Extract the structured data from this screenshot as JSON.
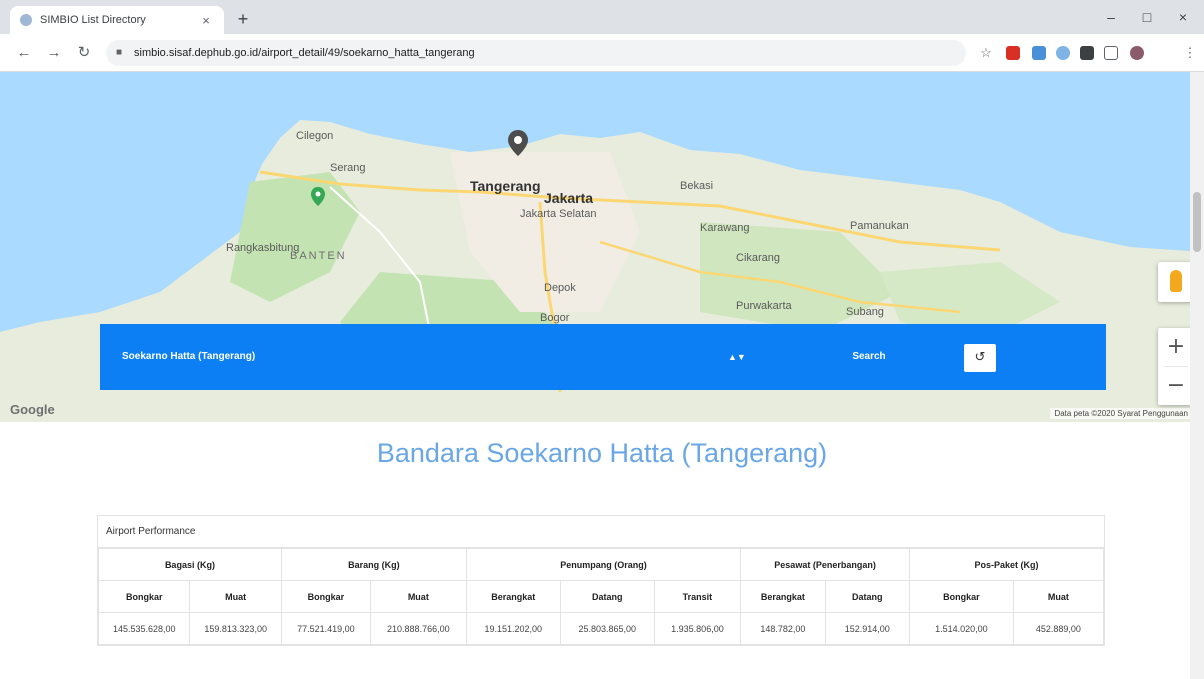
{
  "browser": {
    "tab_title": "SIMBIO List Directory",
    "tab_close": "×",
    "new_tab": "+",
    "url": "simbio.sisaf.dephub.go.id/airport_detail/49/soekarno_hatta_tangerang",
    "minimize": "–",
    "maximize": "□",
    "close": "×"
  },
  "map": {
    "labels": {
      "cilegon": "Cilegon",
      "serang": "Serang",
      "tangerang": "Tangerang",
      "jakarta": "Jakarta",
      "jakarta_selatan": "Jakarta Selatan",
      "banten": "BANTEN",
      "bekasi": "Bekasi",
      "bogor": "Bogor",
      "cikarang": "Cikarang",
      "karawang": "Karawang",
      "purwakarta": "Purwakarta",
      "subang": "Subang",
      "pamanukan": "Pamanukan",
      "rangkasbitung": "Rangkasbitung",
      "depok": "Depok"
    },
    "google": "Google",
    "attribution": "Data peta ©2020   Syarat Penggunaan",
    "zoom_in": "+",
    "zoom_out": "−",
    "colors": {
      "sea": "#aadaff",
      "land": "#e7ecdc",
      "green": "#c4e3b3",
      "urban": "#f1ede4",
      "road": "#fbd774"
    }
  },
  "search": {
    "selected": "Soekarno Hatta (Tangerang)",
    "caret": "▲▼",
    "button": "Search",
    "reset_icon": "↺"
  },
  "page": {
    "title": "Bandara Soekarno Hatta (Tangerang)"
  },
  "performance": {
    "header": "Airport Performance",
    "groups": [
      "Bagasi (Kg)",
      "Barang (Kg)",
      "Penumpang (Orang)",
      "Pesawat (Penerbangan)",
      "Pos-Paket (Kg)"
    ],
    "columns": [
      "Bongkar",
      "Muat",
      "Bongkar",
      "Muat",
      "Berangkat",
      "Datang",
      "Transit",
      "Berangkat",
      "Datang",
      "Bongkar",
      "Muat"
    ],
    "values": [
      "145.535.628,00",
      "159.813.323,00",
      "77.521.419,00",
      "210.888.766,00",
      "19.151.202,00",
      "25.803.865,00",
      "1.935.806,00",
      "148.782,00",
      "152.914,00",
      "1.514.020,00",
      "452.889,00"
    ]
  }
}
